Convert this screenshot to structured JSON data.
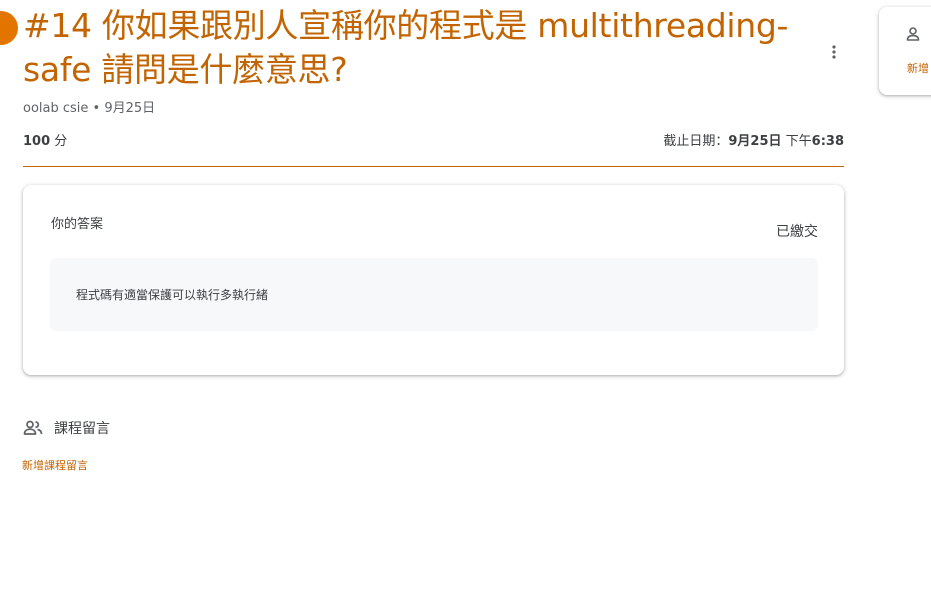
{
  "assignment": {
    "title": "#14 你如果跟別人宣稱你的程式是 multithreading-safe 請問是什麼意思?",
    "meta": "oolab csie • 9月25日",
    "points_value": "100",
    "points_unit": "分",
    "due_label": "截止日期：",
    "due_date": "9月25日",
    "due_time_prefix": "下午",
    "due_time": "6:38",
    "accent_color": "#c26401"
  },
  "answer_card": {
    "label": "你的答案",
    "status": "已繳交",
    "answer_text": "程式碼有適當保護可以執行多執行緒"
  },
  "comments": {
    "header": "課程留言",
    "add_link": "新增課程留言"
  },
  "side_panel": {
    "add_label": "新增"
  },
  "icons": {
    "more": "more-vert-icon",
    "people": "people-icon",
    "person": "person-icon"
  }
}
